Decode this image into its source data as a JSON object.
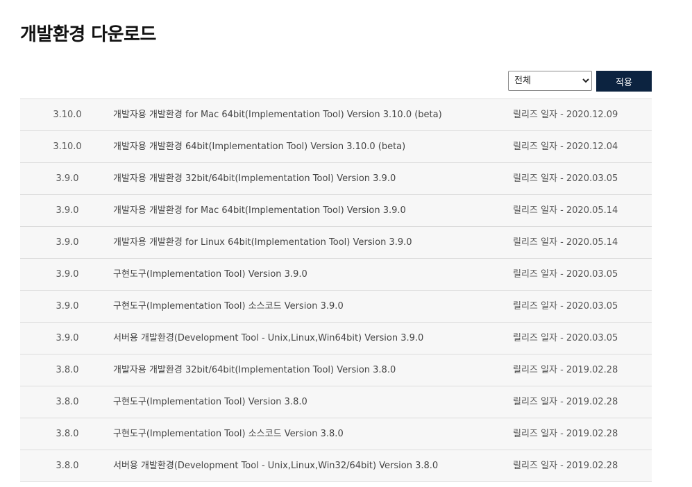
{
  "page": {
    "title": "개발환경 다운로드"
  },
  "filter": {
    "selected": "전체",
    "apply_label": "적용"
  },
  "date_prefix": "릴리즈 일자 - ",
  "rows": [
    {
      "version": "3.10.0",
      "name": "개발자용 개발환경 for Mac 64bit(Implementation Tool) Version 3.10.0 (beta)",
      "date": "릴리즈 일자 - 2020.12.09"
    },
    {
      "version": "3.10.0",
      "name": "개발자용 개발환경 64bit(Implementation Tool) Version 3.10.0 (beta)",
      "date": "릴리즈 일자 - 2020.12.04"
    },
    {
      "version": "3.9.0",
      "name": "개발자용 개발환경 32bit/64bit(Implementation Tool) Version 3.9.0",
      "date": "릴리즈 일자 - 2020.03.05"
    },
    {
      "version": "3.9.0",
      "name": "개발자용 개발환경 for Mac 64bit(Implementation Tool) Version 3.9.0",
      "date": "릴리즈 일자 - 2020.05.14"
    },
    {
      "version": "3.9.0",
      "name": "개발자용 개발환경 for Linux 64bit(Implementation Tool) Version 3.9.0",
      "date": "릴리즈 일자 - 2020.05.14"
    },
    {
      "version": "3.9.0",
      "name": "구현도구(Implementation Tool) Version 3.9.0",
      "date": "릴리즈 일자 - 2020.03.05"
    },
    {
      "version": "3.9.0",
      "name": "구현도구(Implementation Tool) 소스코드 Version 3.9.0",
      "date": "릴리즈 일자 - 2020.03.05"
    },
    {
      "version": "3.9.0",
      "name": "서버용 개발환경(Development Tool - Unix,Linux,Win64bit) Version 3.9.0",
      "date": "릴리즈 일자 - 2020.03.05"
    },
    {
      "version": "3.8.0",
      "name": "개발자용 개발환경 32bit/64bit(Implementation Tool) Version 3.8.0",
      "date": "릴리즈 일자 - 2019.02.28"
    },
    {
      "version": "3.8.0",
      "name": "구현도구(Implementation Tool) Version 3.8.0",
      "date": "릴리즈 일자 - 2019.02.28"
    },
    {
      "version": "3.8.0",
      "name": "구현도구(Implementation Tool) 소스코드 Version 3.8.0",
      "date": "릴리즈 일자 - 2019.02.28"
    },
    {
      "version": "3.8.0",
      "name": "서버용 개발환경(Development Tool - Unix,Linux,Win32/64bit) Version 3.8.0",
      "date": "릴리즈 일자 - 2019.02.28"
    }
  ]
}
